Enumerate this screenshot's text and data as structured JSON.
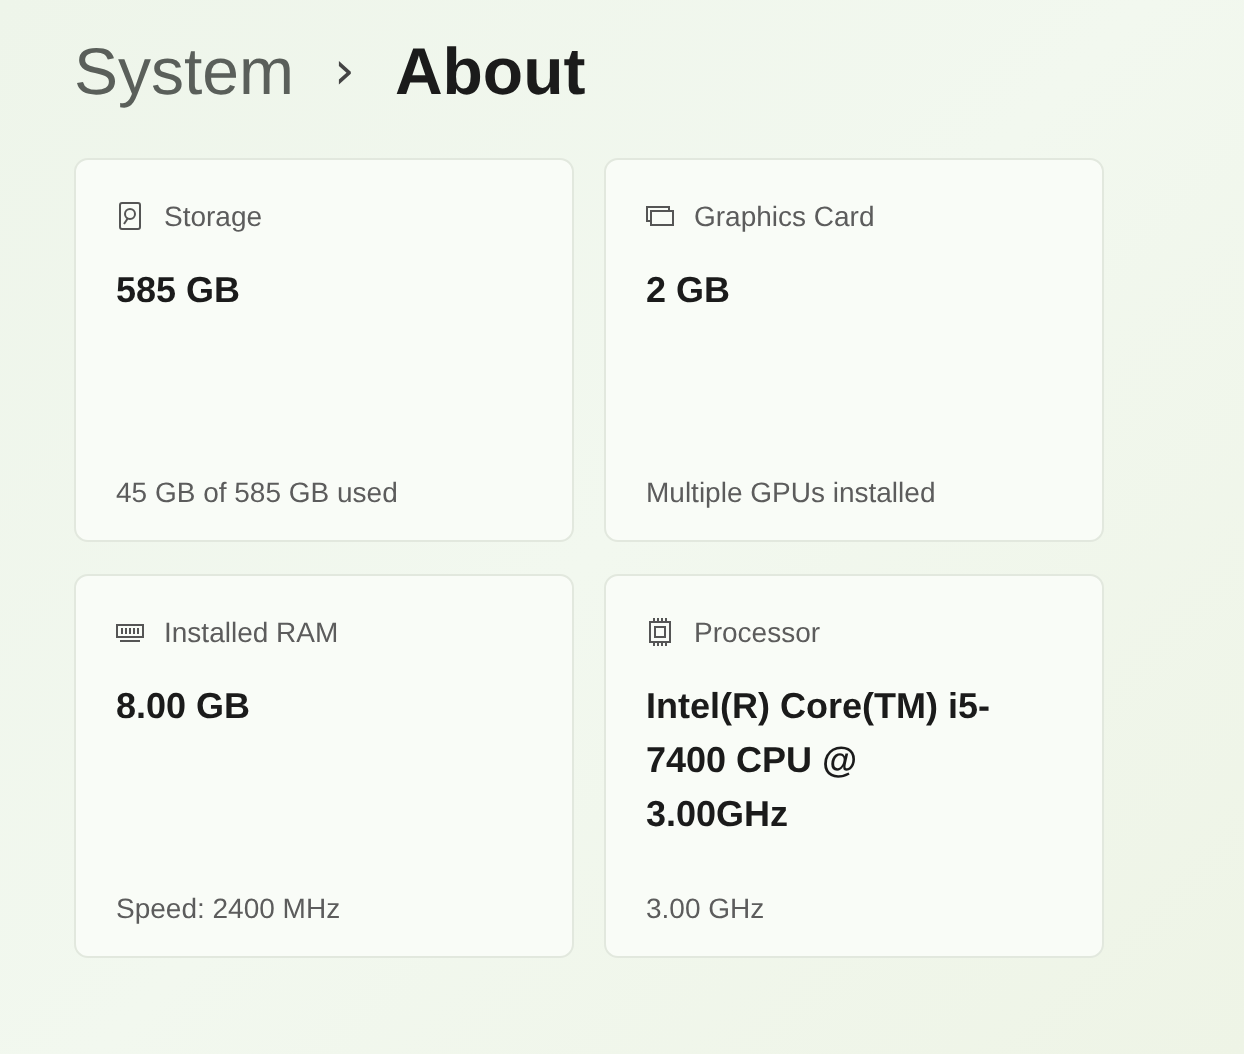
{
  "breadcrumb": {
    "parent": "System",
    "separator": "›",
    "current": "About"
  },
  "cards": [
    {
      "kind": "drive",
      "label": "Storage",
      "value": "585 GB",
      "detail": "45 GB of 585 GB used"
    },
    {
      "kind": "gpu",
      "label": "Graphics Card",
      "value": "2 GB",
      "detail": "Multiple GPUs installed"
    },
    {
      "kind": "ram",
      "label": "Installed RAM",
      "value": "8.00 GB",
      "detail": "Speed: 2400 MHz"
    },
    {
      "kind": "cpu",
      "label": "Processor",
      "value": "Intel(R) Core(TM) i5-7400 CPU @ 3.00GHz",
      "detail": "3.00 GHz"
    }
  ]
}
